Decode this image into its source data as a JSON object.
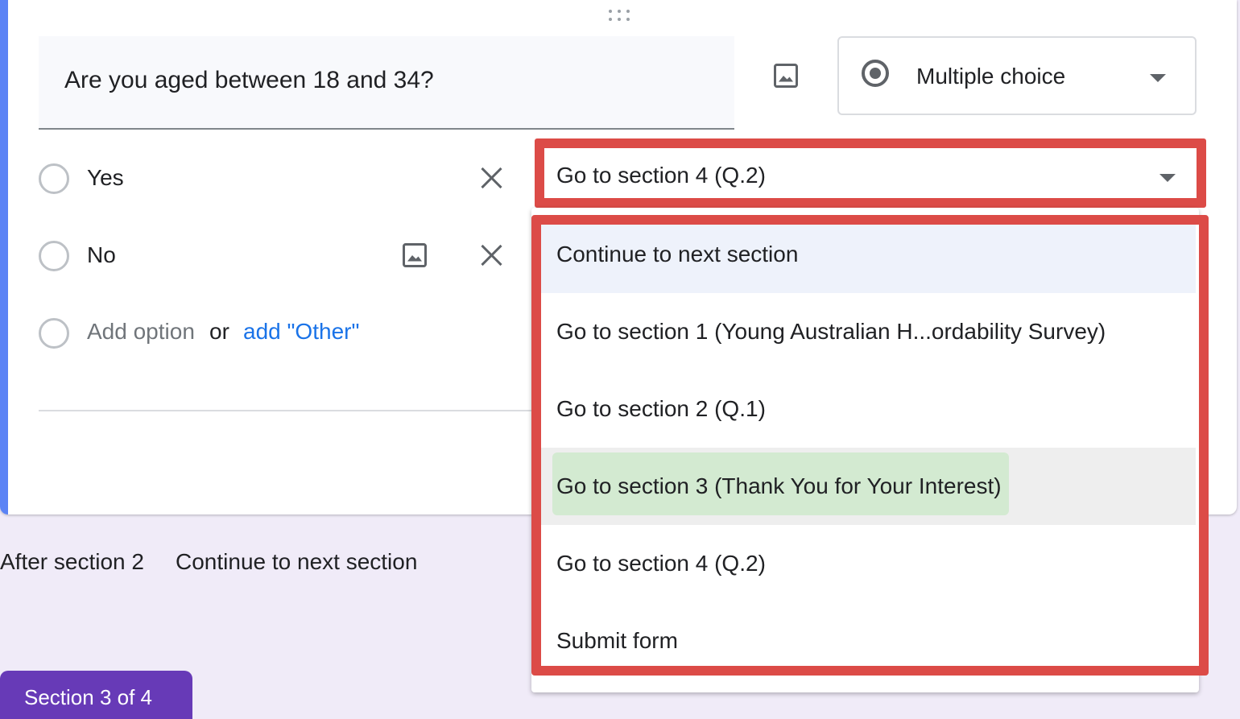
{
  "question": {
    "title": "Are you aged between 18 and 34?",
    "type_label": "Multiple choice",
    "type_icon": "radio-button-icon"
  },
  "options": [
    {
      "label": "Yes"
    },
    {
      "label": "No"
    }
  ],
  "add_option": {
    "label": "Add option",
    "or_text": "or",
    "other_link": "add \"Other\""
  },
  "goto_select": {
    "value": "Go to section 4 (Q.2)"
  },
  "dropdown": {
    "items": [
      {
        "label": "Continue to next section"
      },
      {
        "label": "Go to section 1 (Young Australian H...ordability Survey)"
      },
      {
        "label": "Go to section 2 (Q.1)"
      },
      {
        "label": "Go to section 3 (Thank You for Your Interest)"
      },
      {
        "label": "Go to section 4 (Q.2)"
      },
      {
        "label": "Submit form"
      }
    ]
  },
  "after_section": {
    "label": "After section 2",
    "value": "Continue to next section"
  },
  "section_tab": {
    "label": "Section 3 of 4"
  },
  "colors": {
    "accent_blue": "#5b83f5",
    "annotation_red": "#dc4b47",
    "highlight_green": "#d3ead1",
    "section_purple": "#673ab7",
    "link_blue": "#1a73e8",
    "background": "#f0ebf8"
  }
}
